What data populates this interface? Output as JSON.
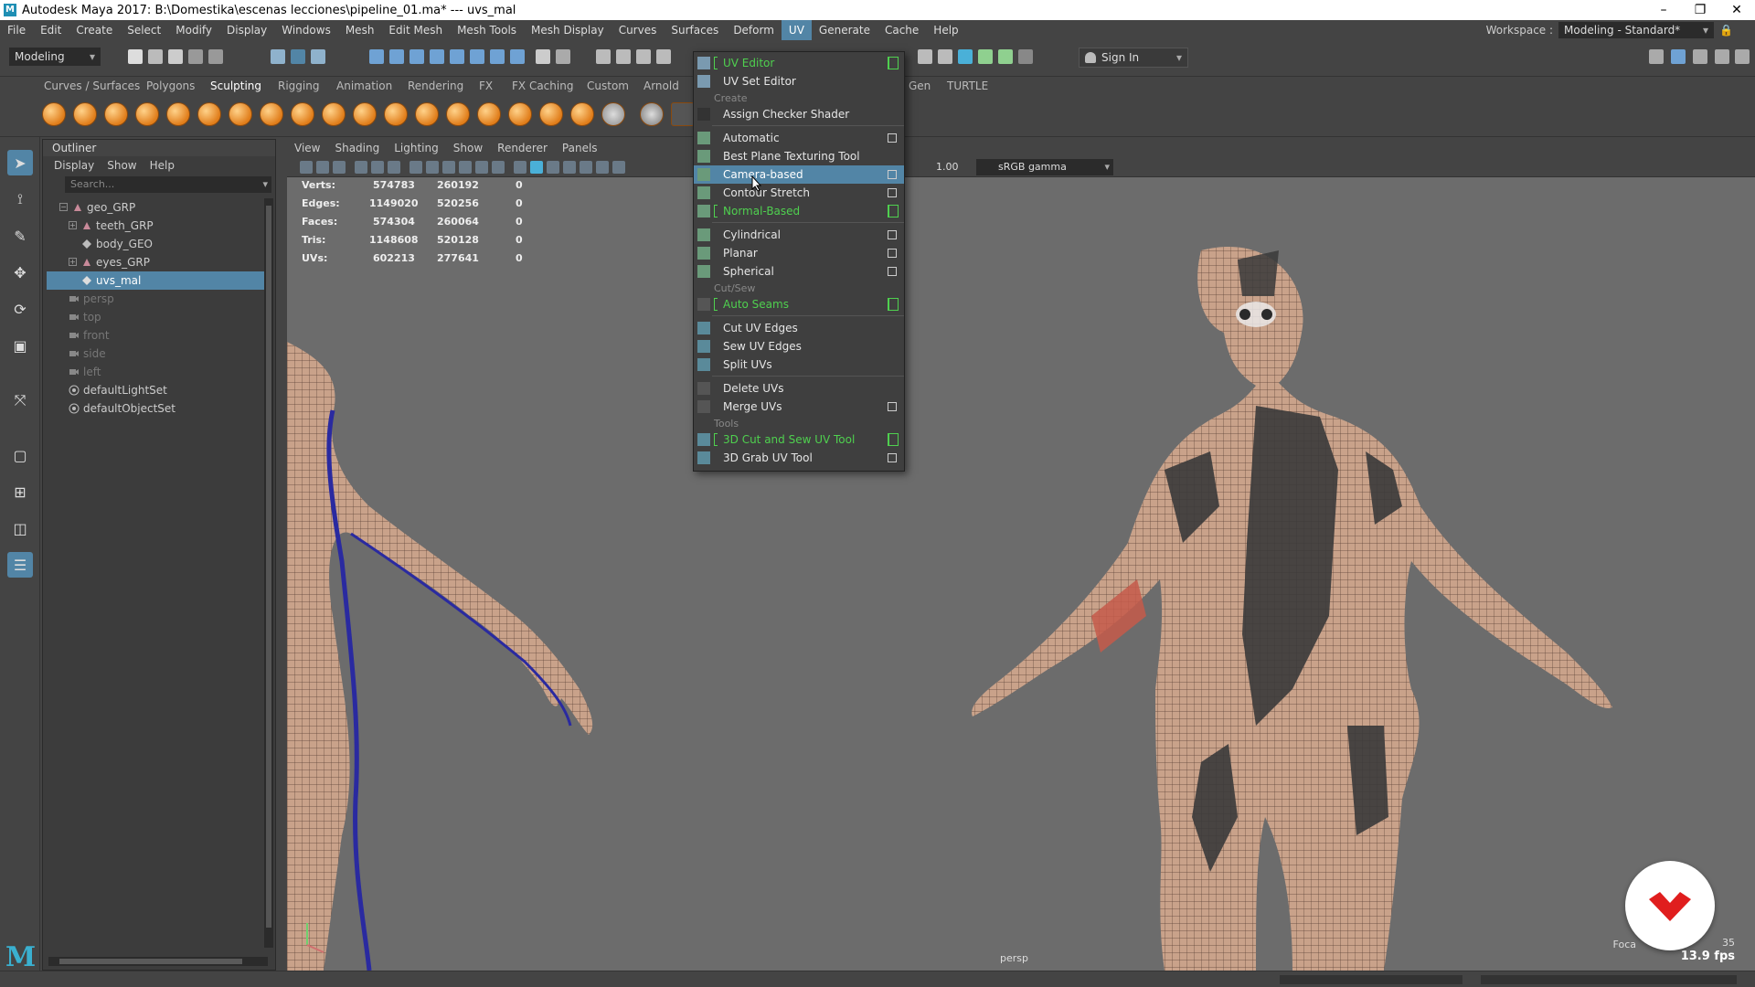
{
  "window": {
    "title": "Autodesk Maya 2017: B:\\Domestika\\escenas lecciones\\pipeline_01.ma*   ---   uvs_mal",
    "controls": [
      "–",
      "❐",
      "✕"
    ]
  },
  "menubar": {
    "items": [
      "File",
      "Edit",
      "Create",
      "Select",
      "Modify",
      "Display",
      "Windows",
      "Mesh",
      "Edit Mesh",
      "Mesh Tools",
      "Mesh Display",
      "Curves",
      "Surfaces",
      "Deform",
      "UV",
      "Generate",
      "Cache",
      "Help"
    ],
    "active": "UV",
    "workspace_label": "Workspace :",
    "workspace_value": "Modeling - Standard*"
  },
  "statusline": {
    "mode": "Modeling",
    "sign_in": "Sign In"
  },
  "shelf": {
    "tabs": [
      "Curves / Surfaces",
      "Polygons",
      "Sculpting",
      "Rigging",
      "Animation",
      "Rendering",
      "FX",
      "FX Caching",
      "Custom",
      "Arnold",
      "Gen",
      "TURTLE"
    ],
    "selected": "Sculpting"
  },
  "outliner": {
    "title": "Outliner",
    "menu": [
      "Display",
      "Show",
      "Help"
    ],
    "search_placeholder": "Search...",
    "items": [
      {
        "label": "geo_GRP"
      },
      {
        "label": "teeth_GRP"
      },
      {
        "label": "body_GEO"
      },
      {
        "label": "eyes_GRP"
      },
      {
        "label": "uvs_mal"
      },
      {
        "label": "persp"
      },
      {
        "label": "top"
      },
      {
        "label": "front"
      },
      {
        "label": "side"
      },
      {
        "label": "left"
      },
      {
        "label": "defaultLightSet"
      },
      {
        "label": "defaultObjectSet"
      }
    ]
  },
  "viewport": {
    "menu": [
      "View",
      "Shading",
      "Lighting",
      "Show",
      "Renderer",
      "Panels"
    ],
    "exposure": "1.00",
    "color_space": "sRGB gamma",
    "camera": "persp",
    "fps": "13.9 fps",
    "focal_label": "Foca",
    "frame": "35",
    "hud": [
      {
        "label": "Verts:",
        "a": "574783",
        "b": "260192",
        "c": "0"
      },
      {
        "label": "Edges:",
        "a": "1149020",
        "b": "520256",
        "c": "0"
      },
      {
        "label": "Faces:",
        "a": "574304",
        "b": "260064",
        "c": "0"
      },
      {
        "label": "Tris:",
        "a": "1148608",
        "b": "520128",
        "c": "0"
      },
      {
        "label": "UVs:",
        "a": "602213",
        "b": "277641",
        "c": "0"
      }
    ]
  },
  "uv_menu": {
    "uv_editor": "UV Editor",
    "uv_set_editor": "UV Set Editor",
    "section_create": "Create",
    "assign_checker": "Assign Checker Shader",
    "automatic": "Automatic",
    "best_plane": "Best Plane Texturing Tool",
    "camera_based": "Camera-based",
    "contour_stretch": "Contour Stretch",
    "normal_based": "Normal-Based",
    "cylindrical": "Cylindrical",
    "planar": "Planar",
    "spherical": "Spherical",
    "section_cutsew": "Cut/Sew",
    "auto_seams": "Auto Seams",
    "cut_uv_edges": "Cut UV Edges",
    "sew_uv_edges": "Sew UV Edges",
    "split_uvs": "Split UVs",
    "delete_uvs": "Delete UVs",
    "merge_uvs": "Merge UVs",
    "section_tools": "Tools",
    "cut_sew_tool": "3D Cut and Sew UV Tool",
    "grab_tool": "3D Grab UV Tool"
  },
  "colors": {
    "accent": "#5285a6",
    "menu_green": "#4fd04f",
    "skin": "#c9a28a",
    "checker_dark": "#3a3a3a",
    "selection_wire": "#2a2aa0"
  }
}
